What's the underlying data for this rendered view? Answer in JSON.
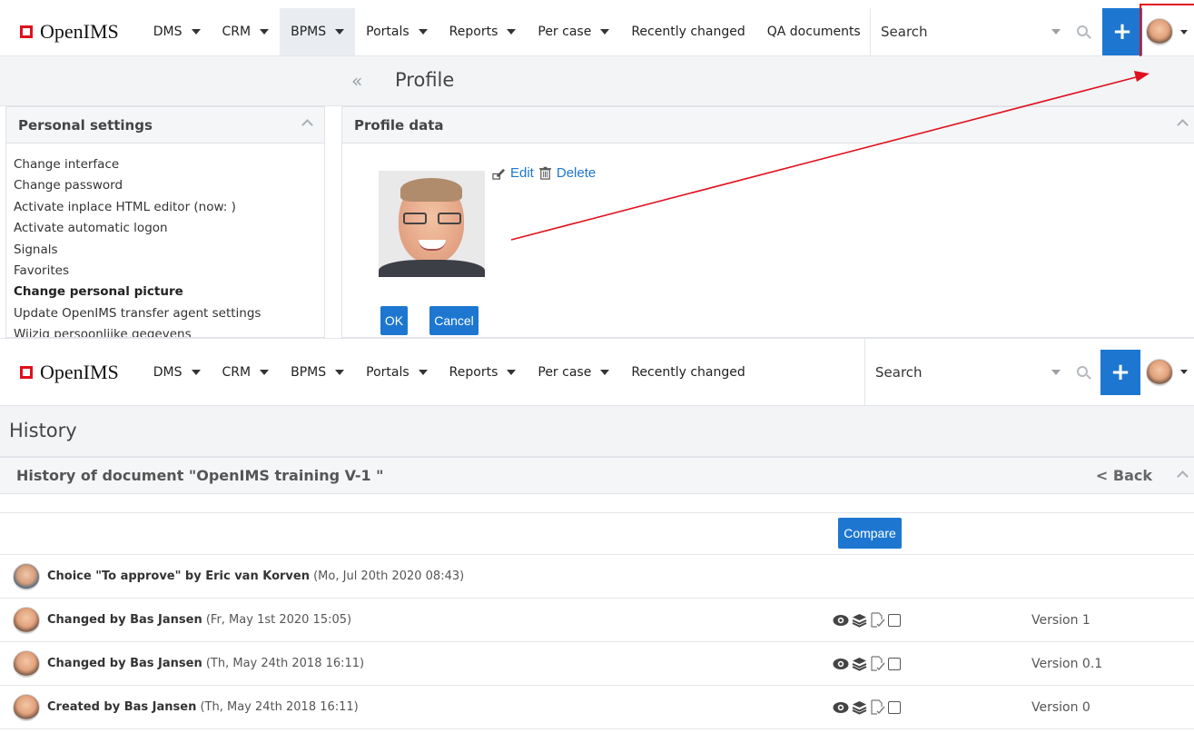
{
  "brand": {
    "name": "OpenIMS",
    "logo_color": "#e0101d"
  },
  "top_nav": {
    "items": [
      {
        "label": "DMS",
        "dropdown": true
      },
      {
        "label": "CRM",
        "dropdown": true
      },
      {
        "label": "BPMS",
        "dropdown": true,
        "active": true
      },
      {
        "label": "Portals",
        "dropdown": true
      },
      {
        "label": "Reports",
        "dropdown": true
      },
      {
        "label": "Per case",
        "dropdown": true
      },
      {
        "label": "Recently changed",
        "dropdown": false
      },
      {
        "label": "QA documents",
        "dropdown": false
      }
    ],
    "search_placeholder": "Search"
  },
  "profile_page": {
    "back_glyph": "«",
    "title": "Profile",
    "settings_panel": {
      "title": "Personal settings",
      "items": [
        {
          "label": "Change interface",
          "bold": false
        },
        {
          "label": "Change password",
          "bold": false
        },
        {
          "label": "Activate inplace HTML editor (now: )",
          "bold": false
        },
        {
          "label": "Activate automatic logon",
          "bold": false
        },
        {
          "label": "Signals",
          "bold": false
        },
        {
          "label": "Favorites",
          "bold": false
        },
        {
          "label": "Change personal picture",
          "bold": true
        },
        {
          "label": "Update OpenIMS transfer agent settings",
          "bold": false
        },
        {
          "label": "Wijzig persoonlijke gegevens",
          "bold": false
        }
      ]
    },
    "profile_panel": {
      "title": "Profile data",
      "edit_label": "Edit",
      "delete_label": "Delete",
      "ok_label": "OK",
      "cancel_label": "Cancel"
    }
  },
  "bottom_nav": {
    "items": [
      {
        "label": "DMS",
        "dropdown": true
      },
      {
        "label": "CRM",
        "dropdown": true
      },
      {
        "label": "BPMS",
        "dropdown": true
      },
      {
        "label": "Portals",
        "dropdown": true
      },
      {
        "label": "Reports",
        "dropdown": true
      },
      {
        "label": "Per case",
        "dropdown": true
      },
      {
        "label": "Recently changed",
        "dropdown": false
      }
    ],
    "search_placeholder": "Search"
  },
  "history_page": {
    "title": "History",
    "panel_title": "History of document \"OpenIMS training V-1 \"",
    "back_label": "< Back",
    "compare_label": "Compare",
    "rows": [
      {
        "actor": "Choice \"To approve\" by Eric van Korven",
        "date": "(Mo, Jul 20th 2020 08:43)",
        "version": "",
        "icons": false,
        "alt_avatar": true
      },
      {
        "actor": "Changed by Bas Jansen",
        "date": "(Fr, May 1st 2020 15:05)",
        "version": "Version 1",
        "icons": true,
        "alt_avatar": false
      },
      {
        "actor": "Changed by Bas Jansen",
        "date": "(Th, May 24th 2018 16:11)",
        "version": "Version 0.1",
        "icons": true,
        "alt_avatar": false
      },
      {
        "actor": "Created by Bas Jansen",
        "date": "(Th, May 24th 2018 16:11)",
        "version": "Version 0",
        "icons": true,
        "alt_avatar": false
      }
    ]
  },
  "colors": {
    "accent": "#1d77d1",
    "annotation": "#e0101d",
    "header_bg": "#f2f4f6"
  }
}
